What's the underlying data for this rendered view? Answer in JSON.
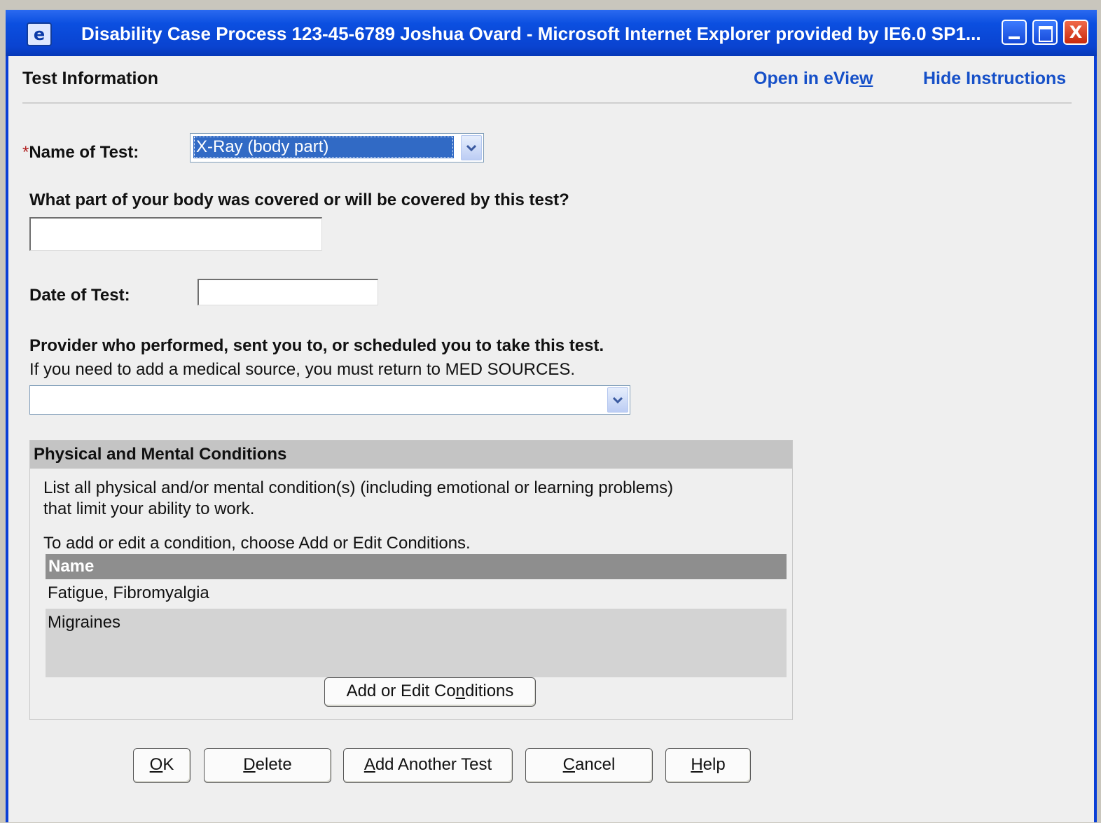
{
  "window": {
    "title": "Disability Case Process 123-45-6789 Joshua Ovard  -  Microsoft Internet Explorer provided by IE6.0 SP1...",
    "close_glyph": "X"
  },
  "header": {
    "title": "Test Information",
    "open_in_eview": {
      "pre": "Open in eVie",
      "accel": "w",
      "post": ""
    },
    "hide_instructions": "Hide Instructions"
  },
  "form": {
    "name_of_test": {
      "required_mark": "*",
      "label": "Name of Test:",
      "selected": "X-Ray (body part)"
    },
    "body_part": {
      "label": "What part of your body was covered or will be covered by this test?",
      "value": ""
    },
    "date_of_test": {
      "label": "Date of Test:",
      "value": ""
    },
    "provider": {
      "label": "Provider who performed, sent you to, or scheduled you to take this test.",
      "help": "If you need to add a medical source, you must return to MED SOURCES.",
      "selected": ""
    }
  },
  "conditions": {
    "title": "Physical and Mental Conditions",
    "intro_line1": "List all physical and/or mental condition(s) (including emotional or learning problems)",
    "intro_line2": "that limit your ability to work.",
    "instruction": "To add or edit a condition, choose Add or Edit Conditions.",
    "column_header": "Name",
    "rows": [
      "Fatigue, Fibromyalgia",
      "Migraines"
    ],
    "edit_button": {
      "pre": "Add or Edit Co",
      "accel": "n",
      "post": "ditions"
    }
  },
  "footer_buttons": {
    "ok": {
      "pre": "",
      "accel": "O",
      "post": "K"
    },
    "delete": {
      "pre": "",
      "accel": "D",
      "post": "elete"
    },
    "add_another": {
      "pre": "",
      "accel": "A",
      "post": "dd Another Test"
    },
    "cancel": {
      "pre": "",
      "accel": "C",
      "post": "ancel"
    },
    "help": {
      "pre": "",
      "accel": "H",
      "post": "elp"
    }
  }
}
